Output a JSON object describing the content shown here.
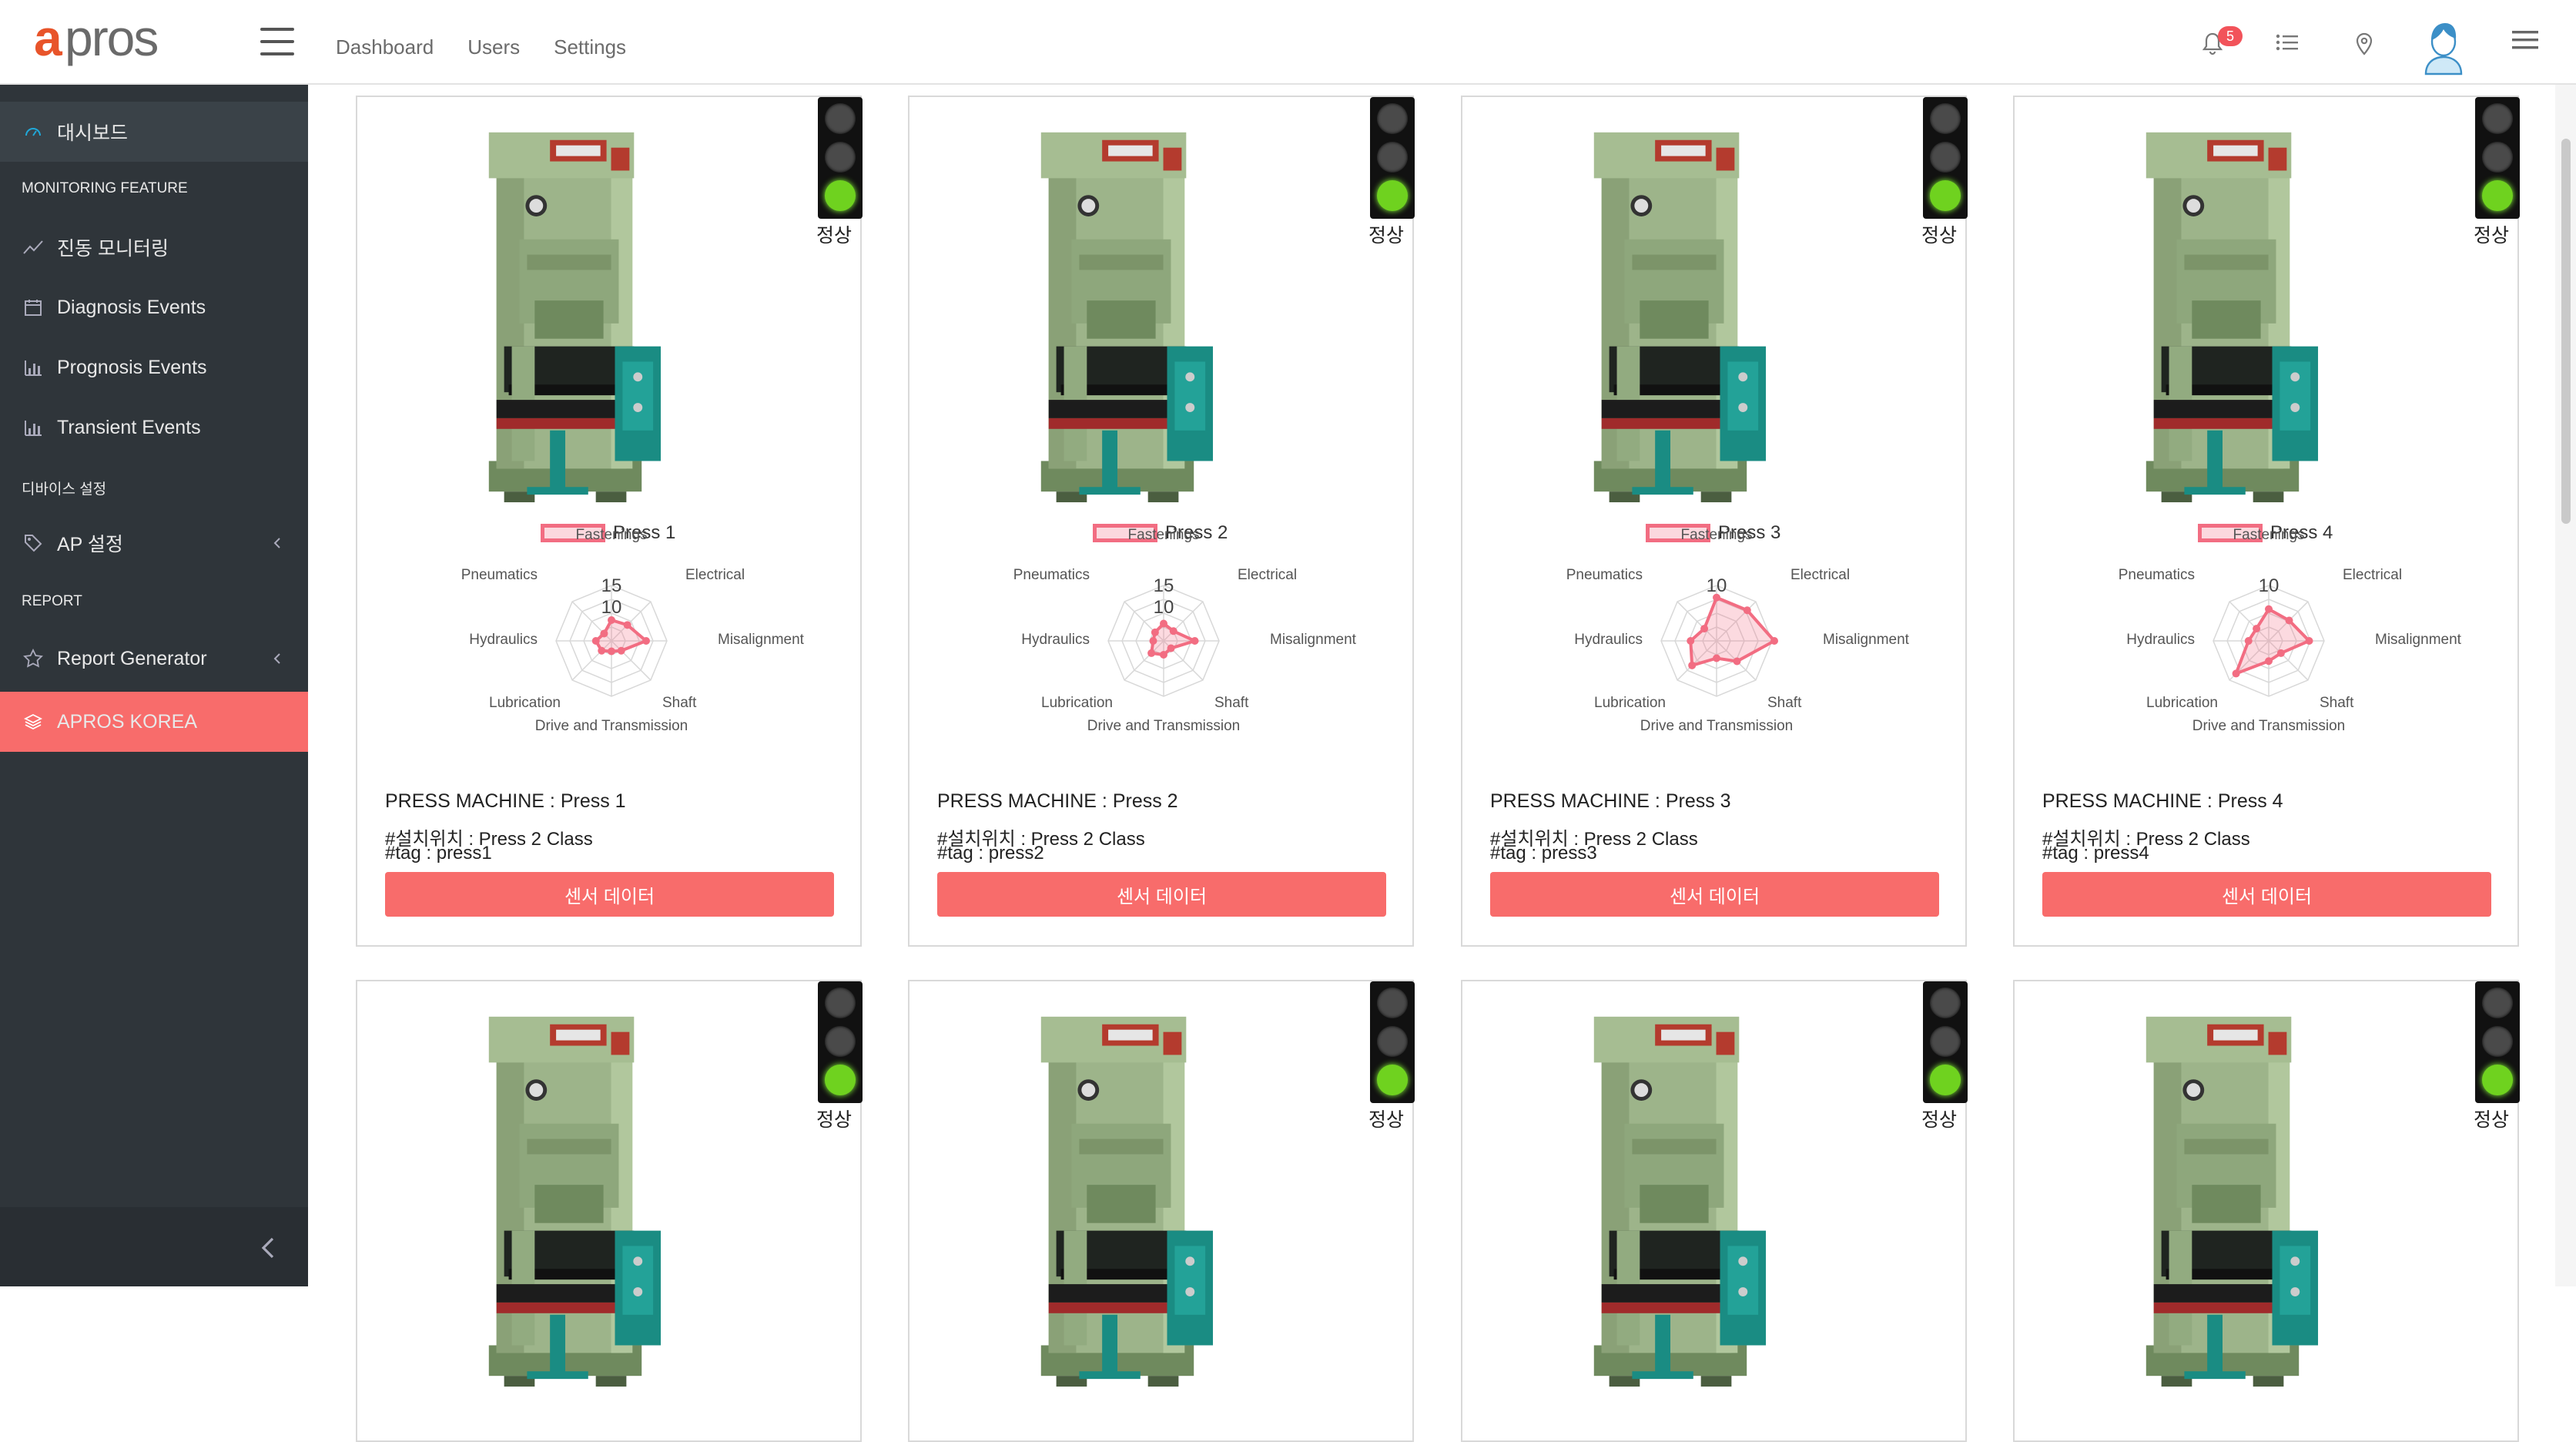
{
  "brand": {
    "accent": "#f86c6b",
    "logo_text": "apros"
  },
  "header": {
    "nav": [
      "Dashboard",
      "Users",
      "Settings"
    ],
    "notification_count": "5"
  },
  "sidebar": {
    "dashboard": "대시보드",
    "section_monitoring": "MONITORING FEATURE",
    "vibration": "진동 모니터링",
    "diagnosis": "Diagnosis Events",
    "prognosis": "Prognosis Events",
    "transient": "Transient Events",
    "section_device": "디바이스 설정",
    "ap_settings": "AP 설정",
    "section_report": "REPORT",
    "report_generator": "Report Generator",
    "company": "APROS KOREA"
  },
  "radar_axes": [
    "Fastenings",
    "Electrical",
    "Misalignment",
    "Shaft",
    "Drive and Transmission",
    "Lubrication",
    "Hydraulics",
    "Pneumatics"
  ],
  "cards": [
    {
      "status": "정상",
      "legend": "Press 1",
      "ticks": [
        "15",
        "10"
      ],
      "values": [
        6,
        6.5,
        10,
        4,
        3,
        4,
        4.5,
        3
      ],
      "scale_max": 20,
      "title": "PRESS MACHINE : Press 1",
      "location": "#설치위치 : Press 2 Class",
      "tag": "#tag : press1",
      "button": "센서 데이터"
    },
    {
      "status": "정상",
      "legend": "Press 2",
      "ticks": [
        "15",
        "10"
      ],
      "values": [
        5,
        4,
        9,
        3,
        4,
        5,
        3,
        3.5
      ],
      "scale_max": 20,
      "title": "PRESS MACHINE : Press 2",
      "location": "#설치위치 : Press 2 Class",
      "tag": "#tag : press2",
      "button": "센서 데이터"
    },
    {
      "status": "정상",
      "legend": "Press 3",
      "ticks": [
        "10"
      ],
      "values": [
        7.5,
        7.5,
        10,
        5,
        3,
        6,
        4.5,
        3
      ],
      "scale_max": 12,
      "title": "PRESS MACHINE : Press 3",
      "location": "#설치위치 : Press 2 Class",
      "tag": "#tag : press3",
      "button": "센서 데이터"
    },
    {
      "status": "정상",
      "legend": "Press 4",
      "ticks": [
        "10"
      ],
      "values": [
        5.5,
        5,
        7,
        3,
        3.5,
        8,
        3.5,
        3
      ],
      "scale_max": 12,
      "title": "PRESS MACHINE : Press 4",
      "location": "#설치위치 : Press 2 Class",
      "tag": "#tag : press4",
      "button": "센서 데이터"
    }
  ],
  "cards_row2": [
    {
      "status": "정상"
    },
    {
      "status": "정상"
    },
    {
      "status": "정상"
    },
    {
      "status": "정상"
    }
  ]
}
